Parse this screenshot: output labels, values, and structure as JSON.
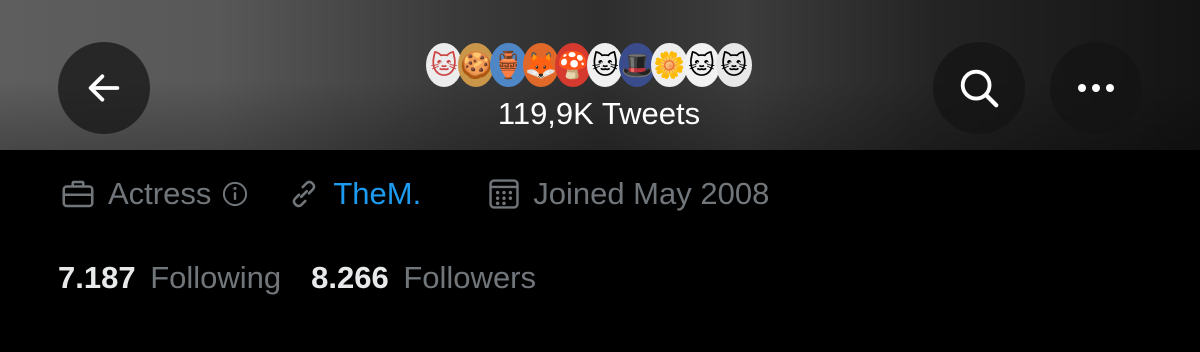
{
  "header": {
    "display_name_emojis": [
      "cat-face-emoji",
      "cookie-emoji",
      "jar-emoji",
      "fox-emoji",
      "mushroom-emoji",
      "cat-face-emoji",
      "wizard-hat-emoji",
      "flower-cat-emoji",
      "cat-face-emoji",
      "cat-face-emoji"
    ],
    "tweets_count": "119,9K Tweets",
    "back_icon": "arrow-left-icon",
    "search_icon": "search-icon",
    "more_icon": "more-icon"
  },
  "profile": {
    "category": "Actress",
    "link": "TheM.",
    "joined": "Joined May 2008",
    "following_count": "7.187",
    "following_label": "Following",
    "followers_count": "8.266",
    "followers_label": "Followers"
  },
  "colors": {
    "link": "#1d9bf0",
    "secondary_text": "#71767b",
    "primary_text": "#e7e9ea",
    "background": "#000000"
  }
}
